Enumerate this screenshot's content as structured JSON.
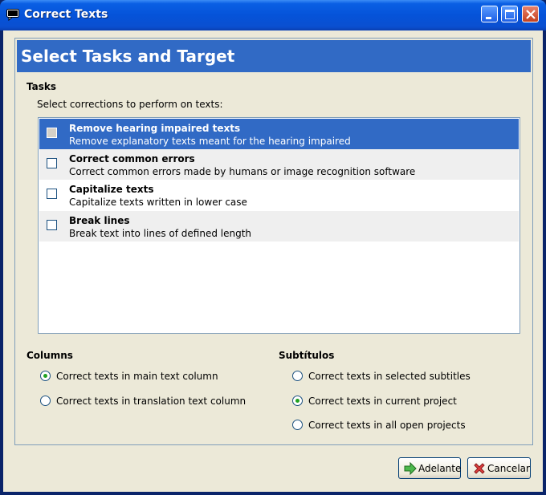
{
  "window": {
    "title": "Correct Texts"
  },
  "header": {
    "title": "Select Tasks and Target"
  },
  "tasks": {
    "section_label": "Tasks",
    "hint": "Select corrections to perform on texts:",
    "items": [
      {
        "title": "Remove hearing impaired texts",
        "description": "Remove explanatory texts meant for the hearing impaired",
        "checked": false,
        "selected": true
      },
      {
        "title": "Correct common errors",
        "description": "Correct common errors made by humans or image recognition software",
        "checked": false,
        "selected": false
      },
      {
        "title": "Capitalize texts",
        "description": "Capitalize texts written in lower case",
        "checked": false,
        "selected": false
      },
      {
        "title": "Break lines",
        "description": "Break text into lines of defined length",
        "checked": false,
        "selected": false
      }
    ]
  },
  "columns": {
    "section_label": "Columns",
    "options": [
      {
        "label": "Correct texts in main text column",
        "selected": true
      },
      {
        "label": "Correct texts in translation text column",
        "selected": false
      }
    ]
  },
  "subtitles": {
    "section_label": "Subtítulos",
    "options": [
      {
        "label": "Correct texts in selected subtitles",
        "selected": false
      },
      {
        "label": "Correct texts in current project",
        "selected": true
      },
      {
        "label": "Correct texts in all open projects",
        "selected": false
      }
    ]
  },
  "buttons": {
    "forward": "Adelante",
    "cancel": "Cancelar"
  },
  "colors": {
    "title_bar": "#0553d9",
    "header": "#316ac5",
    "selection": "#316ac5",
    "radio_dot": "#21a121",
    "dialog_bg": "#ece9d8"
  }
}
